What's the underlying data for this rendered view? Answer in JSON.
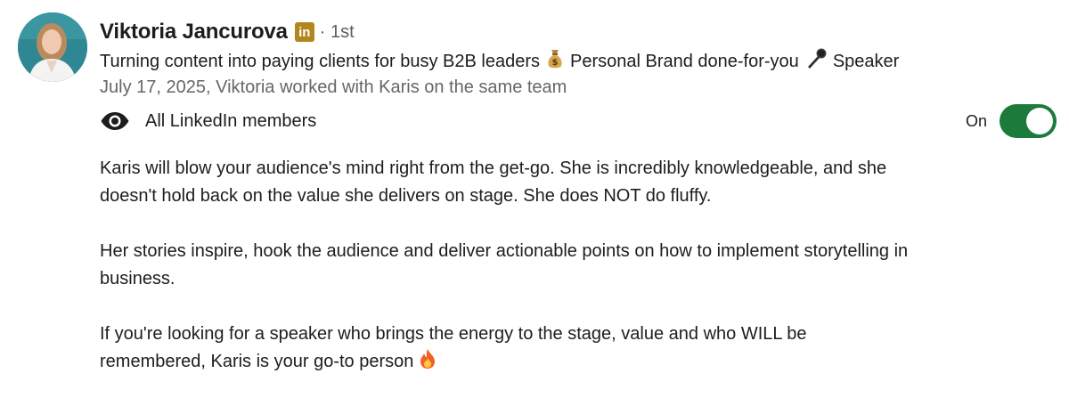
{
  "recommender": {
    "name": "Viktoria Jancurova",
    "badge": "in",
    "degree": "· 1st",
    "headline_part1": "Turning content into paying clients for busy B2B leaders",
    "headline_emoji1": "money-bag",
    "headline_part2": "Personal Brand done-for-you",
    "headline_emoji2": "microphone",
    "headline_part3": "Speaker",
    "meta": "July 17, 2025, Viktoria worked with Karis on the same team"
  },
  "visibility": {
    "label": "All LinkedIn members",
    "icon": "eye-icon",
    "toggle_label": "On",
    "toggle_on": true,
    "toggle_color": "#1c7a3a"
  },
  "recommendation": {
    "paragraph1": "Karis will blow your audience's mind right from the get-go. She is incredibly knowledgeable, and she\ndoesn't hold back on the value she delivers on stage. She does NOT do fluffy.",
    "paragraph2": "Her stories inspire, hook the audience and deliver actionable points on how to implement storytelling in\nbusiness.",
    "paragraph3": "If you're looking for a speaker who brings the energy to the stage, value and who WILL be\nremembered, Karis is your go-to person",
    "paragraph3_emoji": "fire"
  }
}
